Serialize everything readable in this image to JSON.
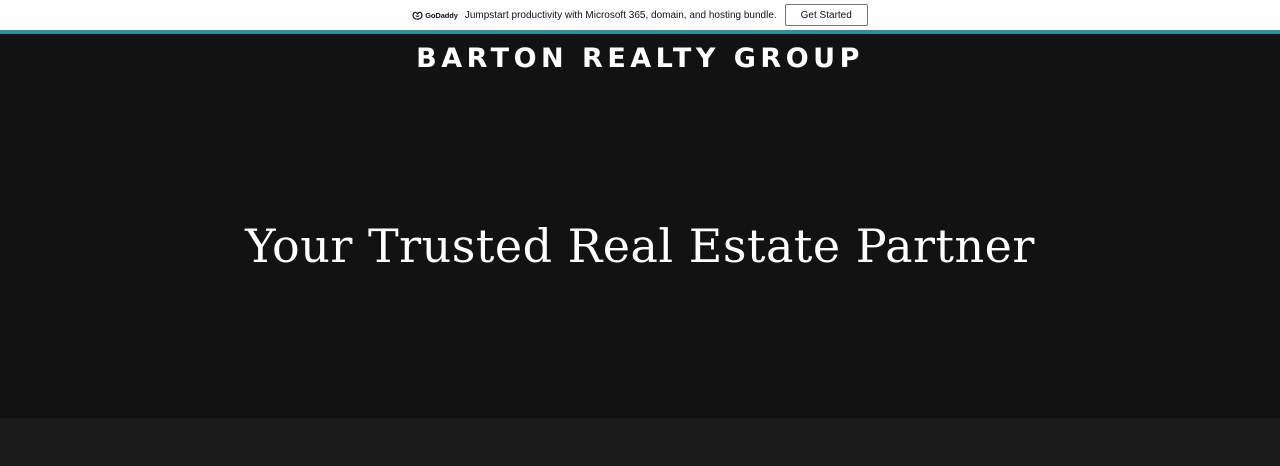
{
  "promo": {
    "brand": "GoDaddy",
    "text": "Jumpstart productivity with Microsoft 365, domain, and hosting bundle.",
    "cta_label": "Get Started"
  },
  "header": {
    "site_title": "BARTON REALTY GROUP"
  },
  "hero": {
    "tagline": "Your Trusted Real Estate Partner"
  },
  "colors": {
    "accent": "#2f8f98",
    "hero_bg": "#121212",
    "promo_bg": "#ffffff"
  }
}
